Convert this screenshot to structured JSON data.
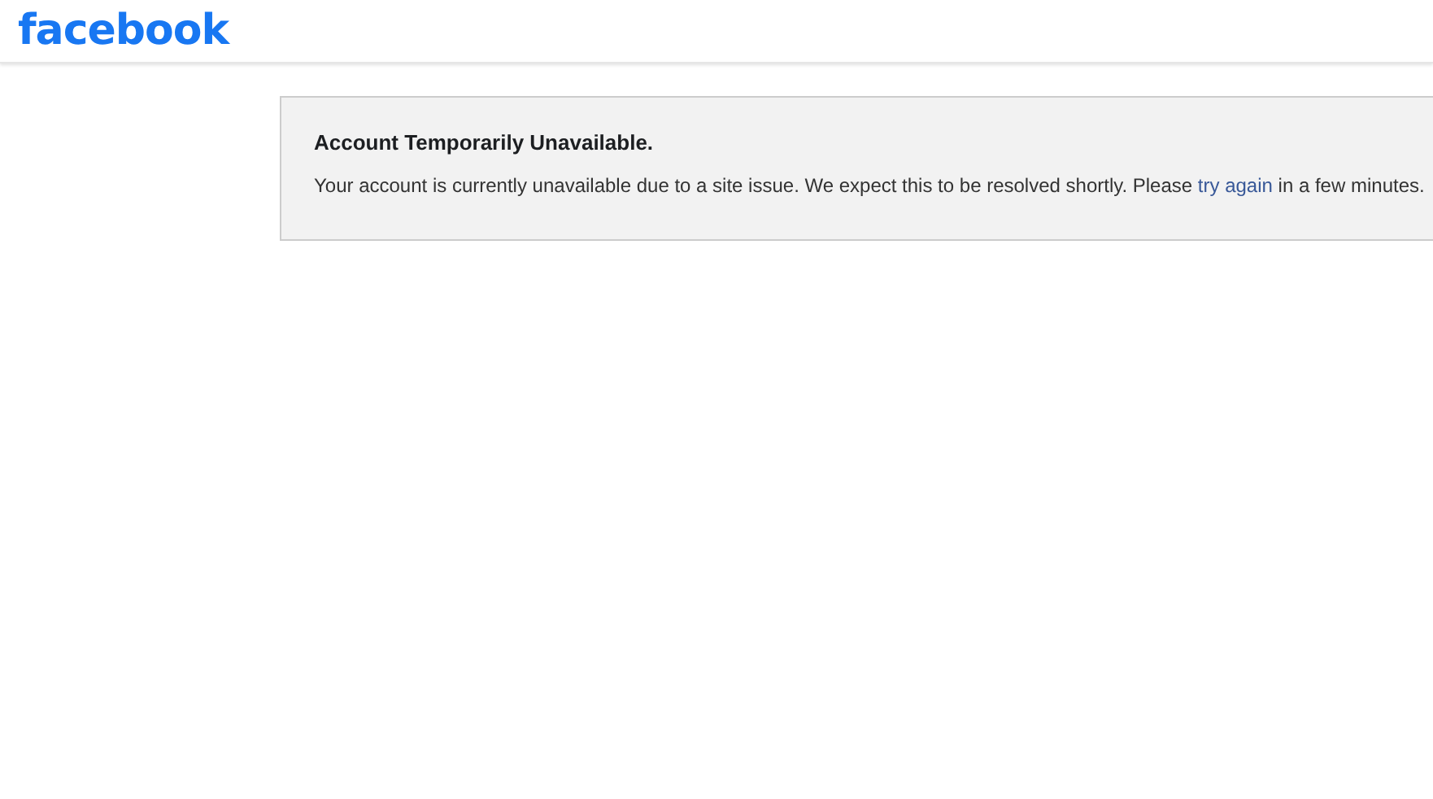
{
  "header": {
    "logo": "facebook"
  },
  "notice": {
    "title": "Account Temporarily Unavailable.",
    "message_before": "Your account is currently unavailable due to a site issue. We expect this to be resolved shortly. Please ",
    "link": "try again",
    "message_after": " in a few minutes."
  }
}
